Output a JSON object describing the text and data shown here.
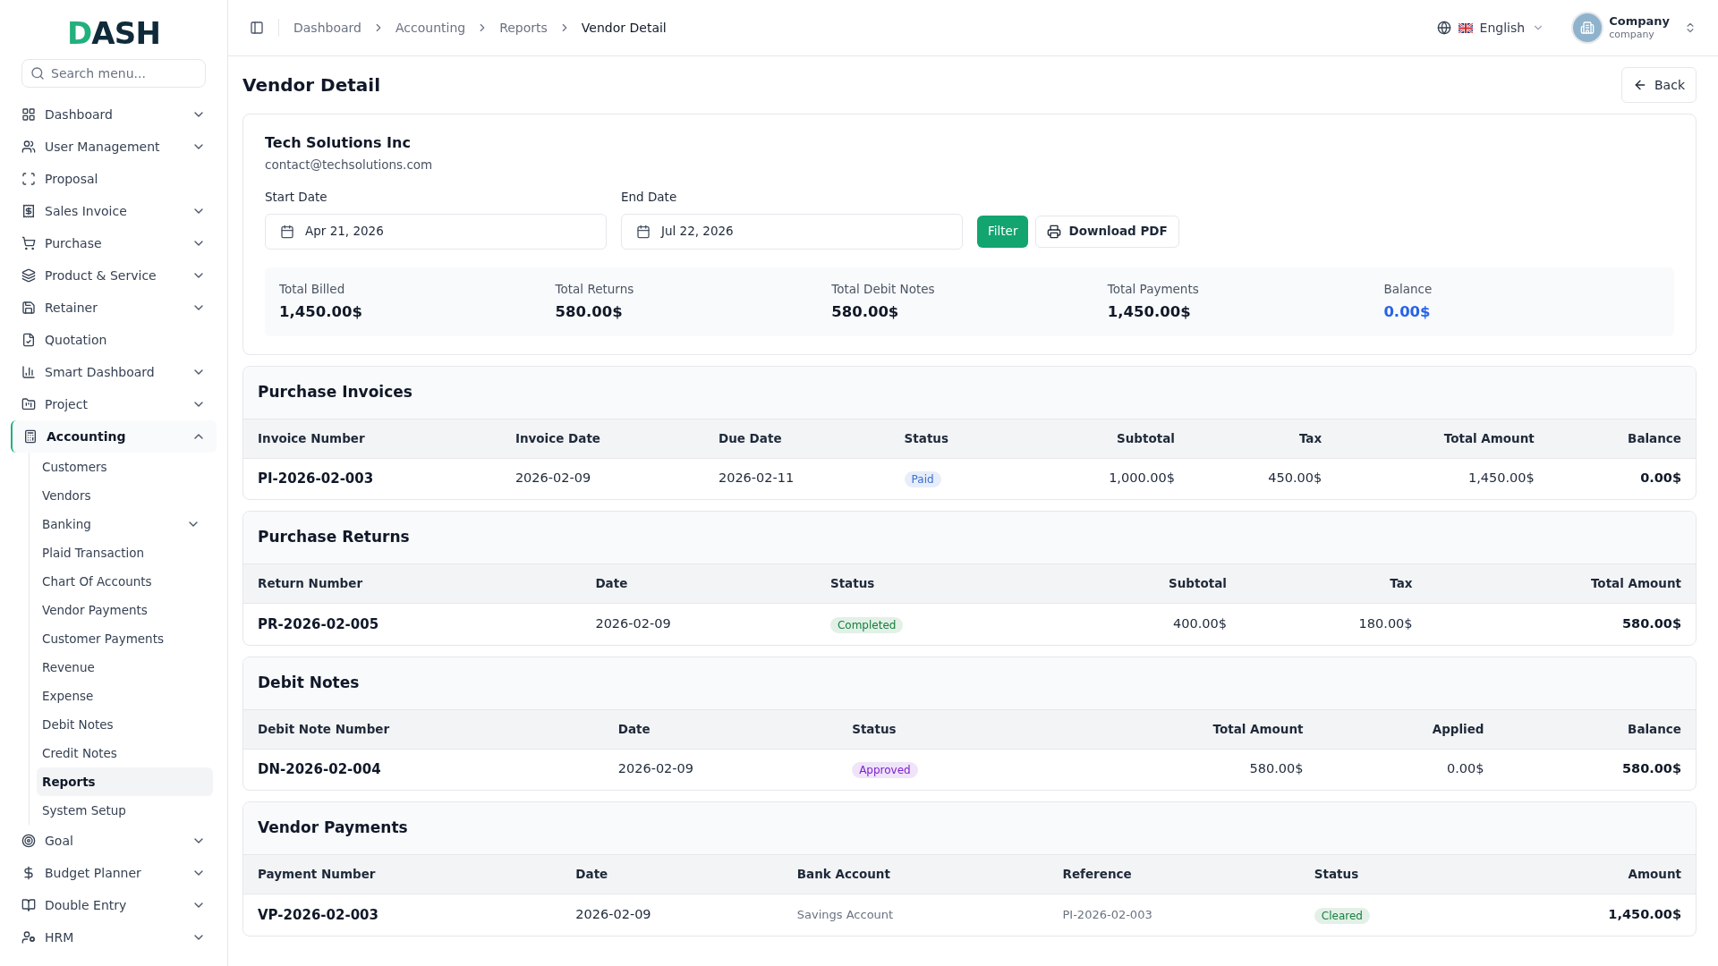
{
  "sidebar": {
    "logo": "DASH",
    "search": {
      "placeholder": "Search menu..."
    },
    "items": [
      {
        "label": "Dashboard",
        "expanded": false,
        "selected": false
      },
      {
        "label": "User Management",
        "expanded": false,
        "selected": false
      },
      {
        "label": "Proposal",
        "selected": false
      },
      {
        "label": "Sales Invoice",
        "expanded": false,
        "selected": false
      },
      {
        "label": "Purchase",
        "expanded": false,
        "selected": false
      },
      {
        "label": "Product & Service",
        "expanded": false,
        "selected": false
      },
      {
        "label": "Retainer",
        "expanded": false,
        "selected": false
      },
      {
        "label": "Quotation",
        "selected": false
      },
      {
        "label": "Smart Dashboard",
        "expanded": false,
        "selected": false
      },
      {
        "label": "Project",
        "expanded": false,
        "selected": false
      },
      {
        "label": "Accounting",
        "expanded": true,
        "selected": true,
        "children": [
          {
            "label": "Customers",
            "selected": false
          },
          {
            "label": "Vendors",
            "selected": false
          },
          {
            "label": "Banking",
            "expanded": false,
            "selected": false
          },
          {
            "label": "Plaid Transaction",
            "selected": false
          },
          {
            "label": "Chart Of Accounts",
            "selected": false
          },
          {
            "label": "Vendor Payments",
            "selected": false
          },
          {
            "label": "Customer Payments",
            "selected": false
          },
          {
            "label": "Revenue",
            "selected": false
          },
          {
            "label": "Expense",
            "selected": false
          },
          {
            "label": "Debit Notes",
            "selected": false
          },
          {
            "label": "Credit Notes",
            "selected": false
          },
          {
            "label": "Reports",
            "selected": true
          },
          {
            "label": "System Setup",
            "selected": false
          }
        ]
      },
      {
        "label": "Goal",
        "expanded": false,
        "selected": false
      },
      {
        "label": "Budget Planner",
        "expanded": false,
        "selected": false
      },
      {
        "label": "Double Entry",
        "expanded": false,
        "selected": false
      },
      {
        "label": "HRM",
        "expanded": false,
        "selected": false
      }
    ]
  },
  "header": {
    "breadcrumbs": [
      "Dashboard",
      "Accounting",
      "Reports",
      "Vendor Detail"
    ],
    "language": "English",
    "user": {
      "name": "Company",
      "role": "company"
    }
  },
  "page": {
    "title": "Vendor Detail",
    "back_button": "Back"
  },
  "vendor": {
    "name": "Tech Solutions Inc",
    "email": "contact@techsolutions.com",
    "start_date": {
      "label": "Start Date",
      "value": "Apr 21, 2026"
    },
    "end_date": {
      "label": "End Date",
      "value": "Jul 22, 2026"
    },
    "filter_button": "Filter",
    "download_button": "Download PDF",
    "summary": [
      {
        "label": "Total Billed",
        "value": "1,450.00$",
        "highlight": false
      },
      {
        "label": "Total Returns",
        "value": "580.00$",
        "highlight": false
      },
      {
        "label": "Total Debit Notes",
        "value": "580.00$",
        "highlight": false
      },
      {
        "label": "Total Payments",
        "value": "1,450.00$",
        "highlight": false
      },
      {
        "label": "Balance",
        "value": "0.00$",
        "highlight": true
      }
    ]
  },
  "tables": [
    {
      "title": "Purchase Invoices",
      "columns": [
        {
          "label": "Invoice Number",
          "kind": "id"
        },
        {
          "label": "Invoice Date",
          "kind": "text"
        },
        {
          "label": "Due Date",
          "kind": "text"
        },
        {
          "label": "Status",
          "kind": "status"
        },
        {
          "label": "Subtotal",
          "kind": "number"
        },
        {
          "label": "Tax",
          "kind": "number"
        },
        {
          "label": "Total Amount",
          "kind": "number"
        },
        {
          "label": "Balance",
          "kind": "total"
        }
      ],
      "rows": [
        [
          "PI-2026-02-003",
          "2026-02-09",
          "2026-02-11",
          {
            "text": "Paid",
            "color": "#3b6fd4"
          },
          "1,000.00$",
          "450.00$",
          "1,450.00$",
          "0.00$"
        ]
      ]
    },
    {
      "title": "Purchase Returns",
      "columns": [
        {
          "label": "Return Number",
          "kind": "id"
        },
        {
          "label": "Date",
          "kind": "text"
        },
        {
          "label": "Status",
          "kind": "status"
        },
        {
          "label": "Subtotal",
          "kind": "number"
        },
        {
          "label": "Tax",
          "kind": "number"
        },
        {
          "label": "Total Amount",
          "kind": "total"
        }
      ],
      "rows": [
        [
          "PR-2026-02-005",
          "2026-02-09",
          {
            "text": "Completed",
            "color": "#15803d"
          },
          "400.00$",
          "180.00$",
          "580.00$"
        ]
      ]
    },
    {
      "title": "Debit Notes",
      "columns": [
        {
          "label": "Debit Note Number",
          "kind": "id"
        },
        {
          "label": "Date",
          "kind": "text"
        },
        {
          "label": "Status",
          "kind": "status"
        },
        {
          "label": "Total Amount",
          "kind": "number"
        },
        {
          "label": "Applied",
          "kind": "number"
        },
        {
          "label": "Balance",
          "kind": "total"
        }
      ],
      "rows": [
        [
          "DN-2026-02-004",
          "2026-02-09",
          {
            "text": "Approved",
            "color": "#7e22ce"
          },
          "580.00$",
          "0.00$",
          "580.00$"
        ]
      ]
    },
    {
      "title": "Vendor Payments",
      "columns": [
        {
          "label": "Payment Number",
          "kind": "id"
        },
        {
          "label": "Date",
          "kind": "text"
        },
        {
          "label": "Bank Account",
          "kind": "muted"
        },
        {
          "label": "Reference",
          "kind": "muted"
        },
        {
          "label": "Status",
          "kind": "status"
        },
        {
          "label": "Amount",
          "kind": "total"
        }
      ],
      "rows": [
        [
          "VP-2026-02-003",
          "2026-02-09",
          "Savings Account",
          "PI-2026-02-003",
          {
            "text": "Cleared",
            "color": "#15803d"
          },
          "1,450.00$"
        ]
      ]
    }
  ]
}
